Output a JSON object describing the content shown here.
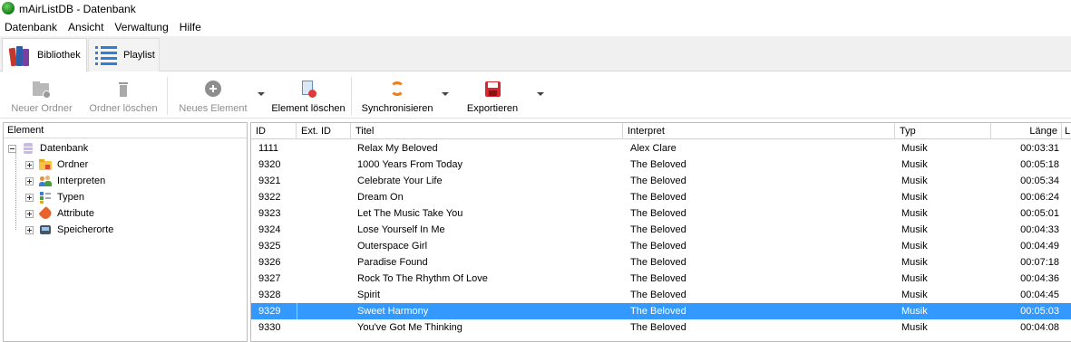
{
  "window": {
    "title": "mAirListDB - Datenbank"
  },
  "menu": [
    "Datenbank",
    "Ansicht",
    "Verwaltung",
    "Hilfe"
  ],
  "tabs": [
    {
      "label": "Bibliothek",
      "icon": "books-icon",
      "active": true
    },
    {
      "label": "Playlist",
      "icon": "playlist-icon",
      "active": false
    }
  ],
  "toolbar": {
    "new_folder": "Neuer Ordner",
    "delete_folder": "Ordner löschen",
    "new_element": "Neues Element",
    "delete_element": "Element löschen",
    "synchronize": "Synchronisieren",
    "export": "Exportieren"
  },
  "tree": {
    "header": "Element",
    "root": "Datenbank",
    "children": [
      "Ordner",
      "Interpreten",
      "Typen",
      "Attribute",
      "Speicherorte"
    ]
  },
  "grid": {
    "columns": [
      "ID",
      "Ext. ID",
      "Titel",
      "Interpret",
      "Typ",
      "Länge",
      "L"
    ],
    "rows": [
      {
        "id": "1111",
        "ext": "",
        "title": "Relax My Beloved",
        "artist": "Alex Clare",
        "type": "Musik",
        "length": "00:03:31"
      },
      {
        "id": "9320",
        "ext": "",
        "title": "1000 Years From Today",
        "artist": "The Beloved",
        "type": "Musik",
        "length": "00:05:18"
      },
      {
        "id": "9321",
        "ext": "",
        "title": "Celebrate Your Life",
        "artist": "The Beloved",
        "type": "Musik",
        "length": "00:05:34"
      },
      {
        "id": "9322",
        "ext": "",
        "title": "Dream On",
        "artist": "The Beloved",
        "type": "Musik",
        "length": "00:06:24"
      },
      {
        "id": "9323",
        "ext": "",
        "title": "Let The Music Take You",
        "artist": "The Beloved",
        "type": "Musik",
        "length": "00:05:01"
      },
      {
        "id": "9324",
        "ext": "",
        "title": "Lose Yourself In Me",
        "artist": "The Beloved",
        "type": "Musik",
        "length": "00:04:33"
      },
      {
        "id": "9325",
        "ext": "",
        "title": "Outerspace Girl",
        "artist": "The Beloved",
        "type": "Musik",
        "length": "00:04:49"
      },
      {
        "id": "9326",
        "ext": "",
        "title": "Paradise Found",
        "artist": "The Beloved",
        "type": "Musik",
        "length": "00:07:18"
      },
      {
        "id": "9327",
        "ext": "",
        "title": "Rock To The Rhythm Of Love",
        "artist": "The Beloved",
        "type": "Musik",
        "length": "00:04:36"
      },
      {
        "id": "9328",
        "ext": "",
        "title": "Spirit",
        "artist": "The Beloved",
        "type": "Musik",
        "length": "00:04:45"
      },
      {
        "id": "9329",
        "ext": "",
        "title": "Sweet Harmony",
        "artist": "The Beloved",
        "type": "Musik",
        "length": "00:05:03",
        "selected": true
      },
      {
        "id": "9330",
        "ext": "",
        "title": "You've Got Me Thinking",
        "artist": "The Beloved",
        "type": "Musik",
        "length": "00:04:08"
      }
    ]
  },
  "colors": {
    "selection": "#3399ff",
    "accent_sync": "#f07d1a",
    "accent_export": "#d9262c"
  }
}
